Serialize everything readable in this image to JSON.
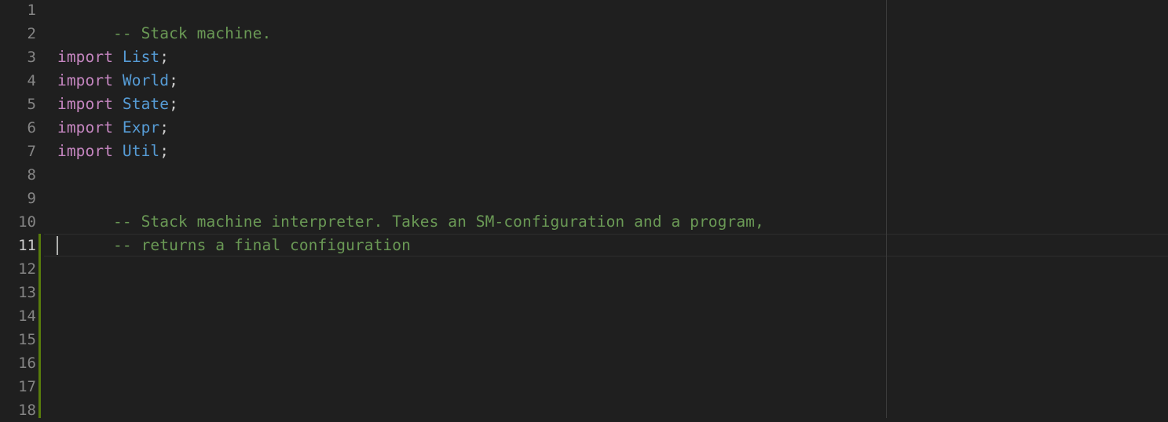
{
  "editor": {
    "line_numbers": [
      "1",
      "2",
      "3",
      "4",
      "5",
      "6",
      "7",
      "8",
      "9",
      "10",
      "11",
      "12",
      "13",
      "14",
      "15",
      "16",
      "17",
      "18"
    ],
    "active_line": "11",
    "lines": {
      "l1": {
        "comment": "-- Stack machine."
      },
      "l3": {
        "keyword": "import",
        "module": "List",
        "punct": ";"
      },
      "l4": {
        "keyword": "import",
        "module": "World",
        "punct": ";"
      },
      "l5": {
        "keyword": "import",
        "module": "State",
        "punct": ";"
      },
      "l6": {
        "keyword": "import",
        "module": "Expr",
        "punct": ";"
      },
      "l7": {
        "keyword": "import",
        "module": "Util",
        "punct": ";"
      },
      "l9": {
        "comment": "-- Stack machine interpreter. Takes an SM-configuration and a program,"
      },
      "l10": {
        "comment": "-- returns a final configuration"
      }
    },
    "colors": {
      "background": "#1f1f1f",
      "keyword": "#c586c0",
      "module": "#569cd6",
      "comment": "#6a9955",
      "line_number": "#858585",
      "diff_added": "#587c0c"
    }
  }
}
